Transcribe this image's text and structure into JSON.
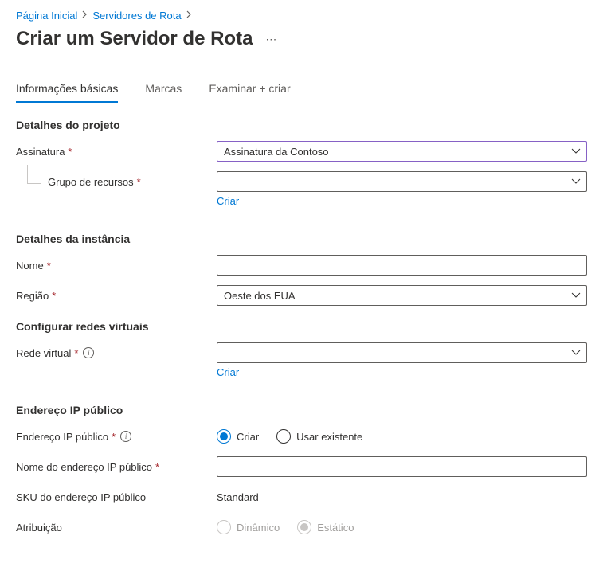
{
  "breadcrumb": {
    "home": "Página Inicial",
    "routeServers": "Servidores de Rota"
  },
  "pageTitle": "Criar um Servidor de Rota",
  "tabs": {
    "basics": "Informações básicas",
    "tags": "Marcas",
    "review": "Examinar + criar"
  },
  "sections": {
    "projectDetails": "Detalhes do projeto",
    "instanceDetails": "Detalhes da instância",
    "configureVnets": "Configurar redes virtuais",
    "publicIp": "Endereço IP público"
  },
  "labels": {
    "subscription": "Assinatura",
    "resourceGroup": "Grupo de recursos",
    "name": "Nome",
    "region": "Região",
    "vnet": "Rede virtual",
    "publicIp": "Endereço IP público",
    "publicIpName": "Nome do endereço IP público",
    "publicIpSku": "SKU do endereço IP público",
    "assignment": "Atribuição"
  },
  "values": {
    "subscription": "Assinatura da Contoso",
    "resourceGroup": "",
    "name": "",
    "region": "Oeste dos EUA",
    "vnet": "",
    "publicIpName": "",
    "publicIpSku": "Standard"
  },
  "links": {
    "create": "Criar"
  },
  "radios": {
    "createNew": "Criar",
    "useExisting": "Usar existente",
    "dynamic": "Dinâmico",
    "static": "Estático"
  }
}
